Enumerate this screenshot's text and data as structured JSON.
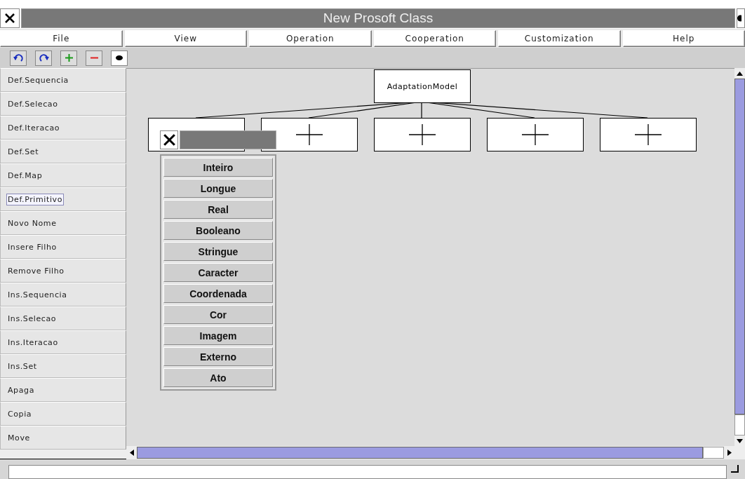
{
  "window": {
    "title": "New Prosoft Class"
  },
  "menu": [
    "File",
    "View",
    "Operation",
    "Cooperation",
    "Customization",
    "Help"
  ],
  "toolbar": [
    {
      "kind": "undo"
    },
    {
      "kind": "redo"
    },
    {
      "kind": "add"
    },
    {
      "kind": "remove"
    },
    {
      "kind": "dot"
    }
  ],
  "sidebar": {
    "items": [
      {
        "label": "Def.Sequencia",
        "selected": false
      },
      {
        "label": "Def.Selecao",
        "selected": false
      },
      {
        "label": "Def.Iteracao",
        "selected": false
      },
      {
        "label": "Def.Set",
        "selected": false
      },
      {
        "label": "Def.Map",
        "selected": false
      },
      {
        "label": "Def.Primitivo",
        "selected": true
      },
      {
        "label": "Novo Nome",
        "selected": false
      },
      {
        "label": "Insere Filho",
        "selected": false
      },
      {
        "label": "Remove Filho",
        "selected": false
      },
      {
        "label": "Ins.Sequencia",
        "selected": false
      },
      {
        "label": "Ins.Selecao",
        "selected": false
      },
      {
        "label": "Ins.Iteracao",
        "selected": false
      },
      {
        "label": "Ins.Set",
        "selected": false
      },
      {
        "label": "Apaga",
        "selected": false
      },
      {
        "label": "Copia",
        "selected": false
      },
      {
        "label": "Move",
        "selected": false
      }
    ]
  },
  "diagram": {
    "root": {
      "label": "AdaptationModel"
    },
    "children": [
      {
        "kind": "empty"
      },
      {
        "kind": "plus"
      },
      {
        "kind": "plus"
      },
      {
        "kind": "plus"
      },
      {
        "kind": "plus"
      }
    ]
  },
  "popup": {
    "items": [
      "Inteiro",
      "Longue",
      "Real",
      "Booleano",
      "Stringue",
      "Caracter",
      "Coordenada",
      "Cor",
      "Imagem",
      "Externo",
      "Ato"
    ]
  }
}
